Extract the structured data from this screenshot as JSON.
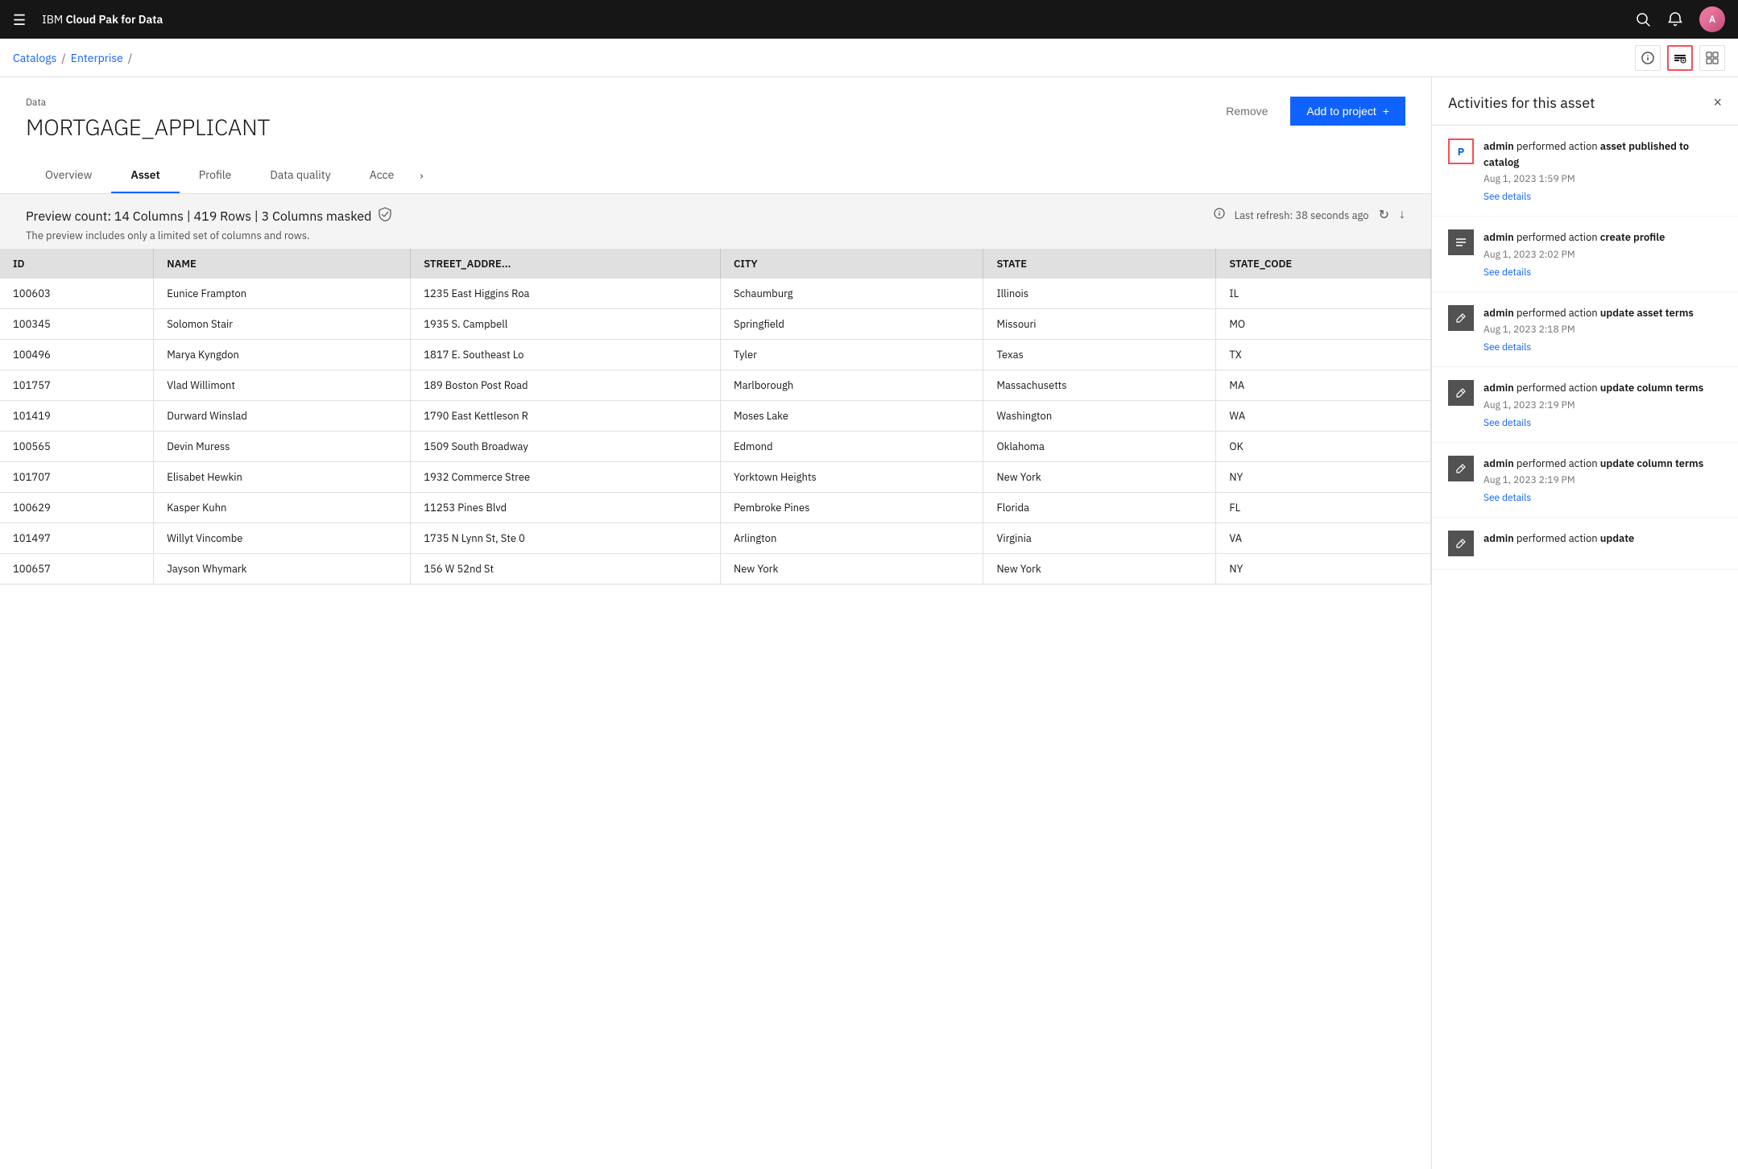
{
  "app": {
    "title_prefix": "IBM ",
    "title_suffix": "Cloud Pak for Data"
  },
  "topnav": {
    "hamburger_label": "☰",
    "search_icon": "🔍",
    "bell_icon": "🔔",
    "avatar_initials": "A"
  },
  "breadcrumb": {
    "catalogs_label": "Catalogs",
    "separator": "/",
    "enterprise_label": "Enterprise",
    "sep2": "/"
  },
  "toolbar_buttons": {
    "info_icon": "ℹ",
    "layout_icon": "⊞",
    "grid_icon": "⊟"
  },
  "asset": {
    "label": "Data",
    "title": "MORTGAGE_APPLICANT",
    "remove_label": "Remove",
    "add_to_project_label": "Add to project",
    "add_icon": "+"
  },
  "tabs": [
    {
      "label": "Overview",
      "active": false
    },
    {
      "label": "Asset",
      "active": true
    },
    {
      "label": "Profile",
      "active": false
    },
    {
      "label": "Data quality",
      "active": false
    },
    {
      "label": "Acce",
      "active": false
    }
  ],
  "preview": {
    "stats": "Preview count:  14 Columns | 419 Rows | 3 Columns masked",
    "note": "The preview includes only a limited set of columns and rows.",
    "refresh_label": "Last refresh: 38 seconds ago",
    "refresh_icon": "↻",
    "download_icon": "↓",
    "info_icon": "ⓘ"
  },
  "table": {
    "columns": [
      "ID",
      "NAME",
      "STREET_ADDRE...",
      "CITY",
      "STATE",
      "STATE_CODE"
    ],
    "rows": [
      [
        "100603",
        "Eunice Frampton",
        "1235 East Higgins Roa",
        "Schaumburg",
        "Illinois",
        "IL"
      ],
      [
        "100345",
        "Solomon Stair",
        "1935 S. Campbell",
        "Springfield",
        "Missouri",
        "MO"
      ],
      [
        "100496",
        "Marya Kyngdon",
        "1817 E. Southeast Lo",
        "Tyler",
        "Texas",
        "TX"
      ],
      [
        "101757",
        "Vlad Willimont",
        "189 Boston Post Road",
        "Marlborough",
        "Massachusetts",
        "MA"
      ],
      [
        "101419",
        "Durward Winslad",
        "1790 East Kettleson R",
        "Moses Lake",
        "Washington",
        "WA"
      ],
      [
        "100565",
        "Devin Muress",
        "1509 South Broadway",
        "Edmond",
        "Oklahoma",
        "OK"
      ],
      [
        "101707",
        "Elisabet Hewkin",
        "1932 Commerce Stree",
        "Yorktown Heights",
        "New York",
        "NY"
      ],
      [
        "100629",
        "Kasper Kuhn",
        "11253 Pines Blvd",
        "Pembroke Pines",
        "Florida",
        "FL"
      ],
      [
        "101497",
        "Willyt Vincombe",
        "1735 N Lynn St, Ste 0",
        "Arlington",
        "Virginia",
        "VA"
      ],
      [
        "100657",
        "Jayson Whymark",
        "156 W 52nd St",
        "New York",
        "New York",
        "NY"
      ]
    ]
  },
  "activities": {
    "panel_title": "Activities for this asset",
    "close_label": "×",
    "items": [
      {
        "icon_type": "publish",
        "icon_label": "P",
        "highlighted": true,
        "text_prefix": "admin",
        "text_action": " performed action ",
        "text_bold": "asset published to catalog",
        "timestamp": "Aug 1, 2023 1:59 PM",
        "see_details": "See details"
      },
      {
        "icon_type": "profile",
        "icon_label": "≡",
        "highlighted": false,
        "text_prefix": "admin",
        "text_action": " performed action ",
        "text_bold": "create profile",
        "timestamp": "Aug 1, 2023 2:02 PM",
        "see_details": "See details"
      },
      {
        "icon_type": "edit",
        "icon_label": "✎",
        "highlighted": false,
        "text_prefix": "admin",
        "text_action": " performed action ",
        "text_bold": "update asset terms",
        "timestamp": "Aug 1, 2023 2:18 PM",
        "see_details": "See details"
      },
      {
        "icon_type": "edit",
        "icon_label": "✎",
        "highlighted": false,
        "text_prefix": "admin",
        "text_action": " performed action ",
        "text_bold": "update column terms",
        "timestamp": "Aug 1, 2023 2:19 PM",
        "see_details": "See details"
      },
      {
        "icon_type": "edit",
        "icon_label": "✎",
        "highlighted": false,
        "text_prefix": "admin",
        "text_action": " performed action ",
        "text_bold": "update column terms",
        "timestamp": "Aug 1, 2023 2:19 PM",
        "see_details": "See details"
      },
      {
        "icon_type": "edit",
        "icon_label": "✎",
        "highlighted": false,
        "text_prefix": "admin",
        "text_action": " performed action ",
        "text_bold": "update",
        "timestamp": "",
        "see_details": ""
      }
    ]
  }
}
